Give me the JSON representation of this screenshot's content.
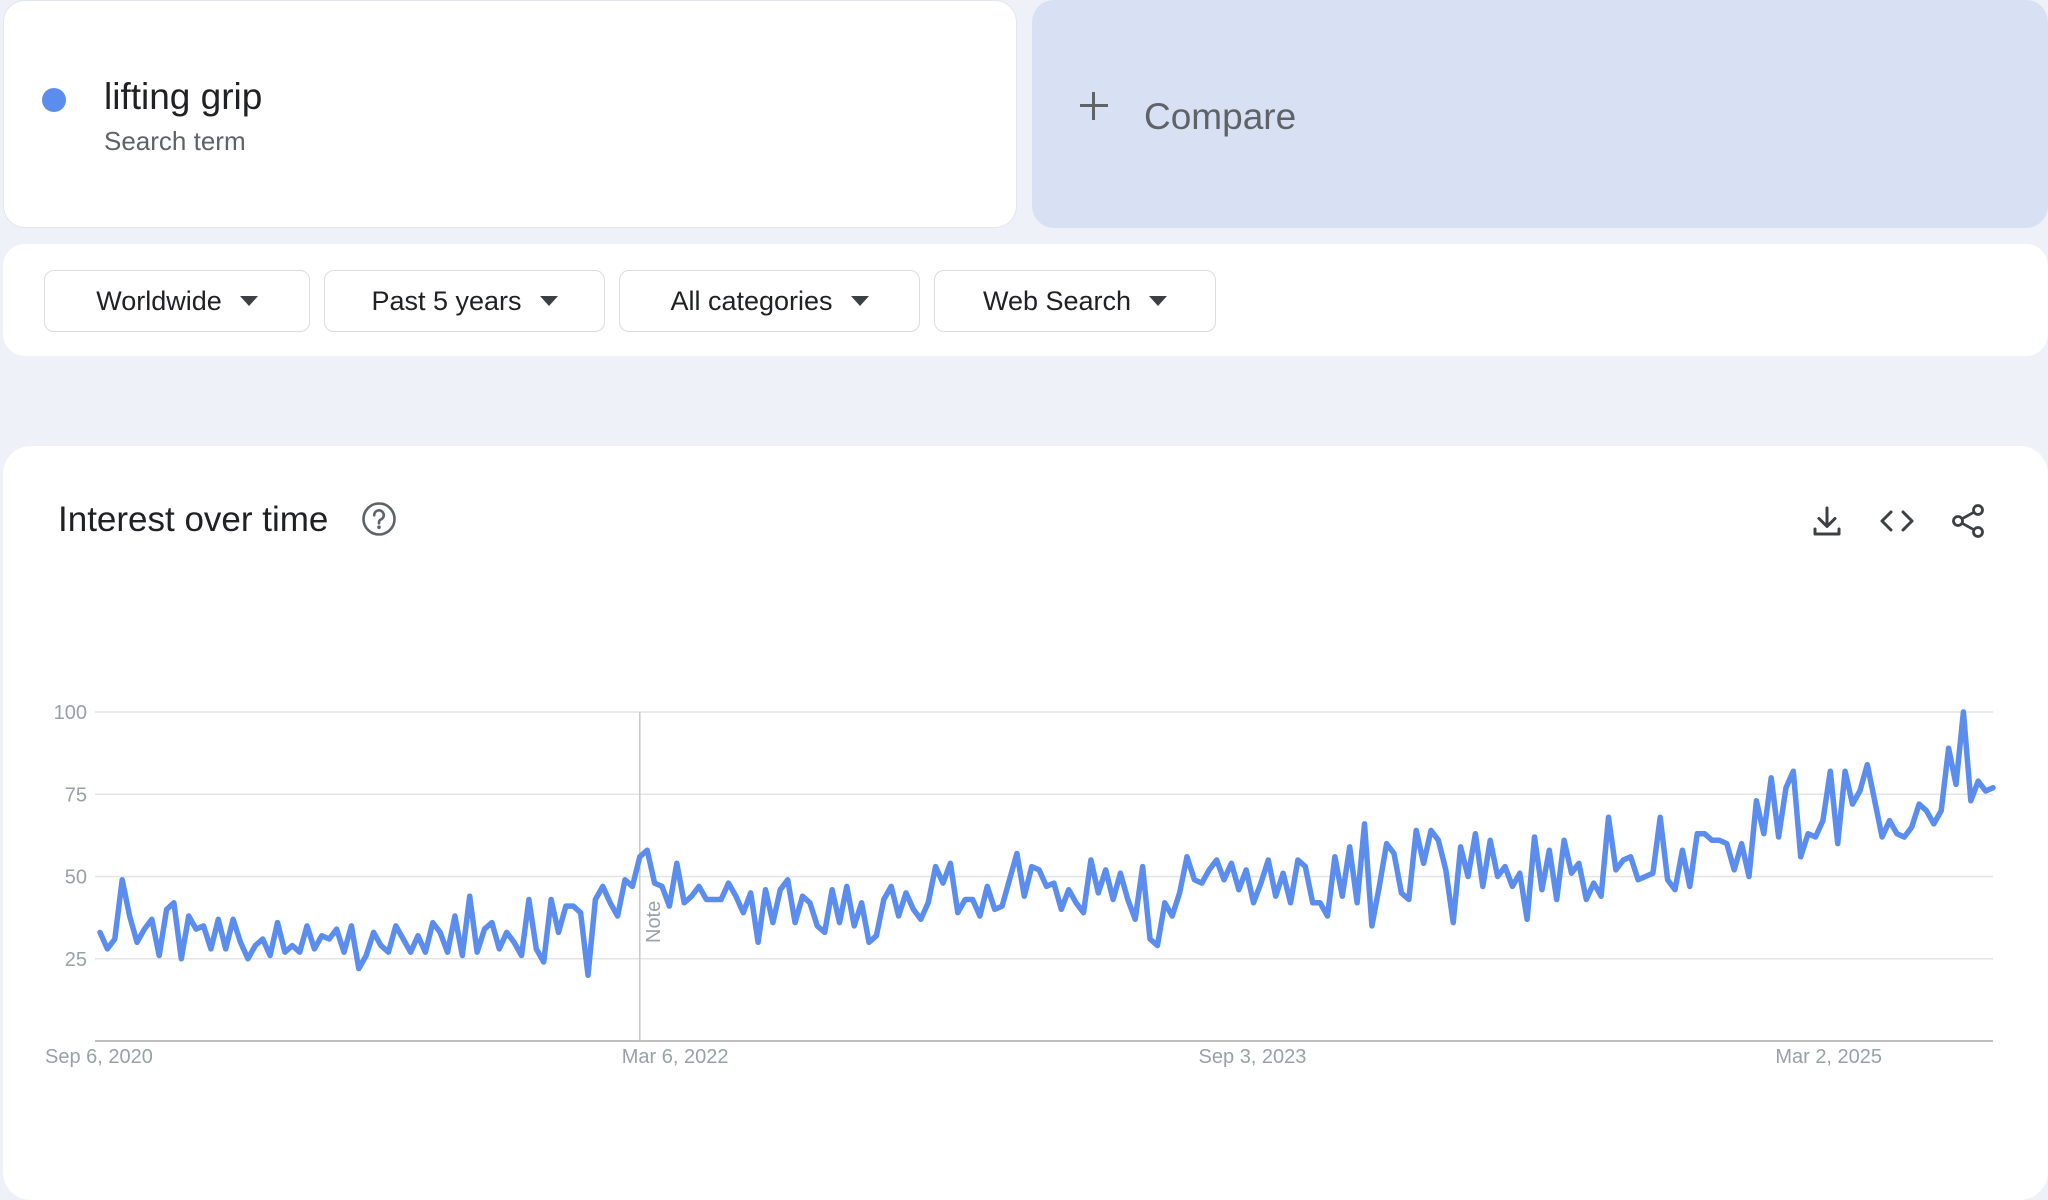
{
  "term": {
    "name": "lifting grip",
    "type": "Search term",
    "color": "#5b8def"
  },
  "compare": {
    "label": "Compare",
    "icon": "plus-icon"
  },
  "filters": [
    {
      "label": "Worldwide",
      "icon": "caret-down-icon"
    },
    {
      "label": "Past 5 years",
      "icon": "caret-down-icon"
    },
    {
      "label": "All categories",
      "icon": "caret-down-icon"
    },
    {
      "label": "Web Search",
      "icon": "caret-down-icon"
    }
  ],
  "panel": {
    "title": "Interest over time",
    "help_icon": "help-circle-icon",
    "tools": [
      "download-icon",
      "embed-code-icon",
      "share-icon"
    ]
  },
  "chart_data": {
    "type": "line",
    "title": "",
    "xlabel": "",
    "ylabel": "",
    "ylim": [
      0,
      100
    ],
    "yticks": [
      25,
      50,
      75,
      100
    ],
    "xtick_labels": [
      "Sep 6, 2020",
      "Mar 6, 2022",
      "Sep 3, 2023",
      "Mar 2, 2025"
    ],
    "x_start": "2020-09-06",
    "x_step_days": 7,
    "grid": true,
    "line_color": "#5b8def",
    "annotations": [
      {
        "text": "Note",
        "x": "2022-01-30"
      }
    ],
    "series": [
      {
        "values": [
          33,
          28,
          31,
          49,
          38,
          30,
          34,
          37,
          26,
          40,
          42,
          25,
          38,
          34,
          35,
          28,
          37,
          28,
          37,
          30,
          25,
          29,
          31,
          26,
          36,
          27,
          29,
          27,
          35,
          28,
          32,
          31,
          34,
          27,
          35,
          22,
          26,
          33,
          29,
          27,
          35,
          31,
          27,
          32,
          27,
          36,
          33,
          27,
          38,
          26,
          44,
          27,
          34,
          36,
          28,
          33,
          30,
          26,
          43,
          28,
          24,
          43,
          33,
          41,
          41,
          39,
          20,
          43,
          47,
          42,
          38,
          49,
          47,
          56,
          58,
          48,
          47,
          41,
          54,
          42,
          44,
          47,
          43,
          43,
          43,
          48,
          44,
          39,
          45,
          30,
          46,
          36,
          46,
          49,
          36,
          44,
          42,
          35,
          33,
          46,
          36,
          47,
          35,
          42,
          30,
          32,
          43,
          47,
          38,
          45,
          40,
          37,
          42,
          53,
          48,
          54,
          39,
          43,
          43,
          38,
          47,
          40,
          41,
          49,
          57,
          44,
          53,
          52,
          47,
          48,
          40,
          46,
          42,
          39,
          55,
          45,
          52,
          43,
          51,
          43,
          37,
          53,
          31,
          29,
          42,
          38,
          45,
          56,
          49,
          48,
          52,
          55,
          49,
          54,
          46,
          52,
          42,
          48,
          55,
          44,
          51,
          42,
          55,
          53,
          42,
          42,
          38,
          56,
          44,
          59,
          42,
          66,
          35,
          47,
          60,
          57,
          45,
          43,
          64,
          54,
          64,
          61,
          52,
          36,
          59,
          50,
          63,
          47,
          61,
          50,
          53,
          47,
          51,
          37,
          62,
          46,
          58,
          43,
          61,
          51,
          54,
          43,
          48,
          44,
          68,
          52,
          55,
          56,
          49,
          50,
          51,
          68,
          49,
          46,
          58,
          47,
          63,
          63,
          61,
          61,
          60,
          52,
          60,
          50,
          73,
          63,
          80,
          62,
          77,
          82,
          56,
          63,
          62,
          67,
          82,
          60,
          82,
          72,
          76,
          84,
          73,
          62,
          67,
          63,
          62,
          65,
          72,
          70,
          66,
          70,
          89,
          78,
          100,
          73,
          79,
          76,
          77
        ]
      }
    ]
  }
}
